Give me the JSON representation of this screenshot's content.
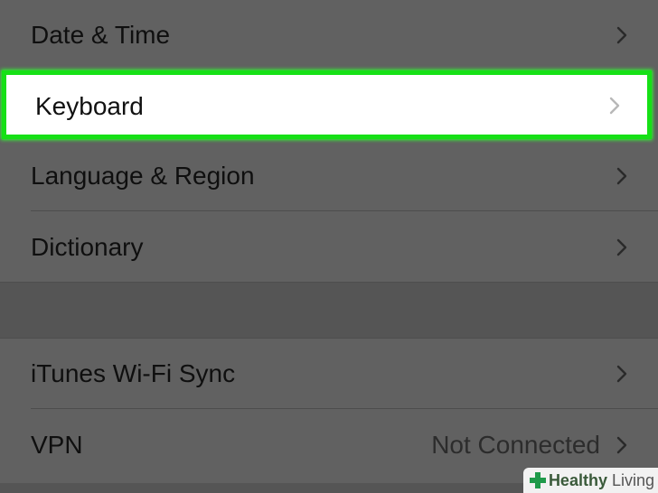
{
  "settings": {
    "group1": [
      {
        "label": "Date & Time"
      },
      {
        "label": "Keyboard",
        "highlighted": true
      },
      {
        "label": "Language & Region"
      },
      {
        "label": "Dictionary"
      }
    ],
    "group2": [
      {
        "label": "iTunes Wi-Fi Sync"
      },
      {
        "label": "VPN",
        "value": "Not Connected"
      }
    ]
  },
  "watermark": {
    "brand_bold": "Healthy",
    "brand_rest": " Living"
  },
  "colors": {
    "highlight_border": "#16e016",
    "dimmed_background": "#616161",
    "watermark_plus": "#1f9a4a"
  },
  "icons": {
    "disclosure": "chevron-right-icon",
    "watermark_logo": "plus-cross-icon"
  }
}
